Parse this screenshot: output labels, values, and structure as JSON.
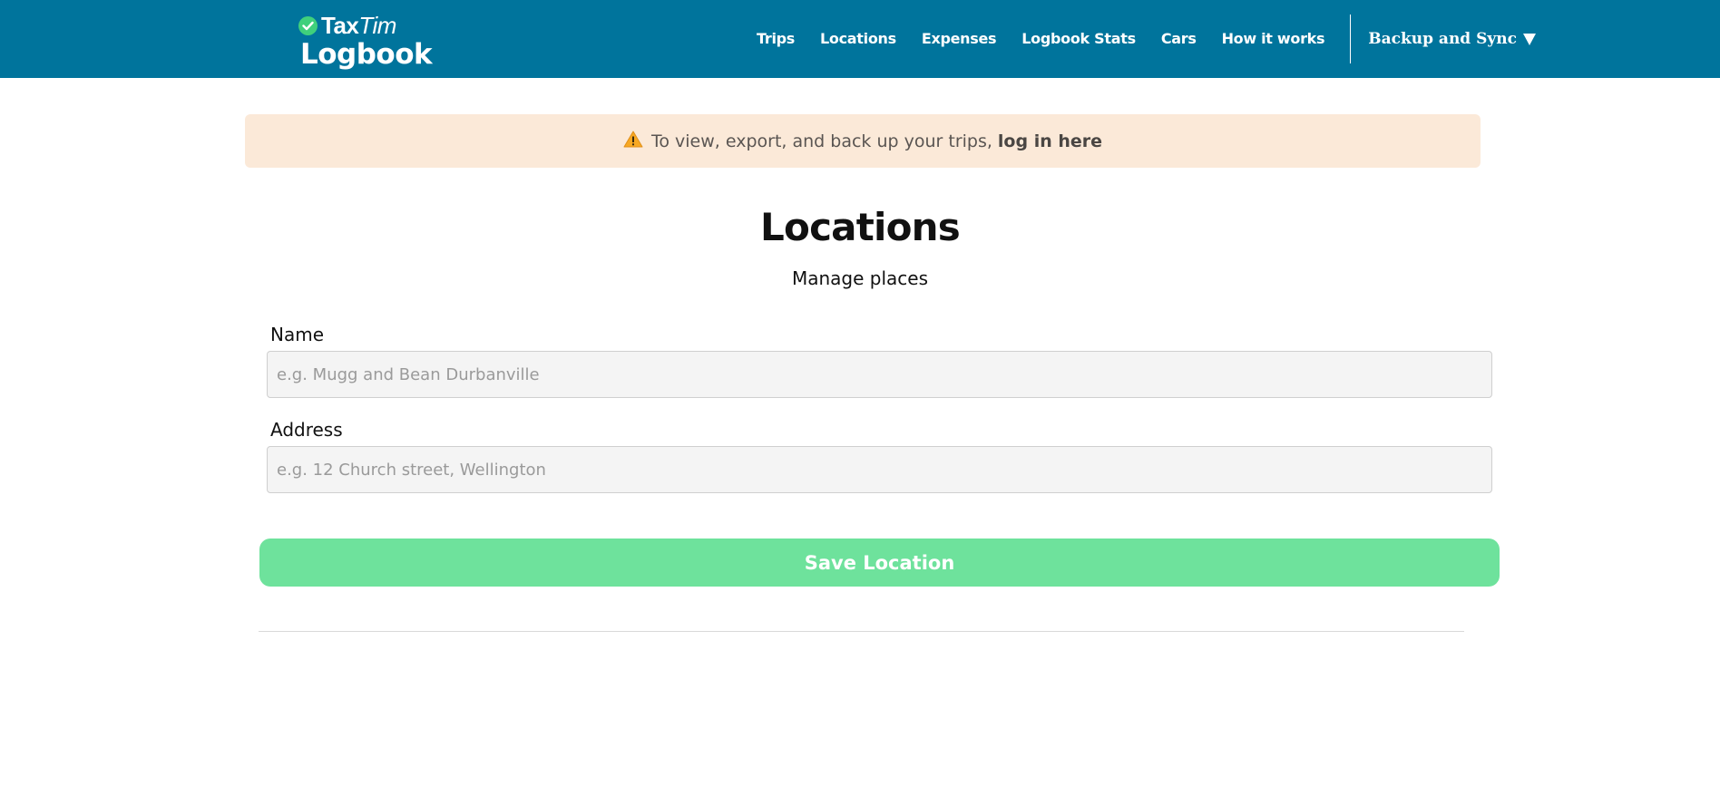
{
  "brand": {
    "taxtim_main": "Tax",
    "taxtim_italic": "Tim",
    "product": "Logbook"
  },
  "nav": {
    "items": [
      {
        "label": "Trips"
      },
      {
        "label": "Locations"
      },
      {
        "label": "Expenses"
      },
      {
        "label": "Logbook Stats"
      },
      {
        "label": "Cars"
      },
      {
        "label": "How it works"
      }
    ],
    "sync_label": "Backup and Sync"
  },
  "alert": {
    "message": "To view, export, and back up your trips,",
    "link_label": "log in here"
  },
  "page": {
    "title": "Locations",
    "subtitle": "Manage places"
  },
  "form": {
    "name_label": "Name",
    "name_placeholder": "e.g. Mugg and Bean Durbanville",
    "address_label": "Address",
    "address_placeholder": "e.g. 12 Church street, Wellington",
    "save_label": "Save Location"
  },
  "colors": {
    "header_bg": "#00749c",
    "alert_bg": "#fbe9d8",
    "save_button_bg": "#6ee29c",
    "check_badge": "#3fd07c"
  },
  "icons": {
    "brand_badge": "check-icon",
    "alert": "warning-icon",
    "dropdown": "caret-down-icon"
  }
}
